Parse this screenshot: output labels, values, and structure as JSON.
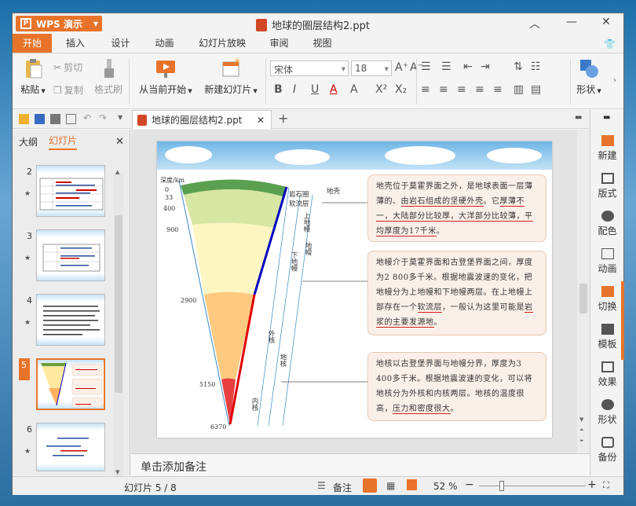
{
  "app": {
    "name": "WPS 演示",
    "doc_title": "地球的圈层结构2.ppt"
  },
  "tabs": [
    "开始",
    "插入",
    "设计",
    "动画",
    "幻灯片放映",
    "审阅",
    "视图"
  ],
  "ribbon": {
    "paste": "粘贴",
    "cut": "剪切",
    "copy": "复制",
    "format_painter": "格式刷",
    "from_current": "从当前开始",
    "new_slide": "新建幻灯片",
    "font_name": "宋体",
    "font_size": "18",
    "shape": "形状"
  },
  "doc_tab": "地球的圈层结构2.ppt",
  "panel_tabs": {
    "outline": "大纲",
    "slides": "幻灯片"
  },
  "slides": [
    {
      "num": "2"
    },
    {
      "num": "3"
    },
    {
      "num": "4"
    },
    {
      "num": "5"
    },
    {
      "num": "6"
    }
  ],
  "slide": {
    "depth_label": "深度/km",
    "depths": [
      "0",
      "33",
      "400",
      "900",
      "2900",
      "5150",
      "6370"
    ],
    "layers": [
      "岩石圈",
      "软流层",
      "地壳",
      "上地幔",
      "下地幔",
      "地幔",
      "外核",
      "内核",
      "地核"
    ],
    "box1": {
      "a": "地壳位于莫霍界面之外，是地球表面一层薄薄的、",
      "u1": "由岩石组成的坚硬外壳",
      "b": "。它",
      "u2": "厚薄不一，大陆部分比较厚，大洋部分比较薄，平均厚度为17千米",
      "c": "。"
    },
    "box2": {
      "a": "地幔介于莫霍界面和古登堡界面之间，厚度为2 800多千米。根据地震波速的变化，把地幔分为上地幔和下地幔两层。在上地幔上部存在一个",
      "u1": "软流层",
      "b": "，一般认为这里可能是",
      "u2": "岩浆的主要发源地",
      "c": "。"
    },
    "box3": {
      "a": "地核以古登堡界面与地幔分界，厚度为3 400多千米。根据地震波速的变化，可以将地核分为外核和内核两层。地核的温度很高，",
      "u1": "压力和密度很大",
      "b": "。"
    }
  },
  "notes_placeholder": "单击添加备注",
  "right_panel": [
    "新建",
    "版式",
    "配色",
    "动画",
    "切换",
    "模板",
    "效果",
    "形状",
    "备份"
  ],
  "status": {
    "slide_info": "幻灯片 5 / 8",
    "notes": "备注",
    "zoom": "52 %"
  }
}
